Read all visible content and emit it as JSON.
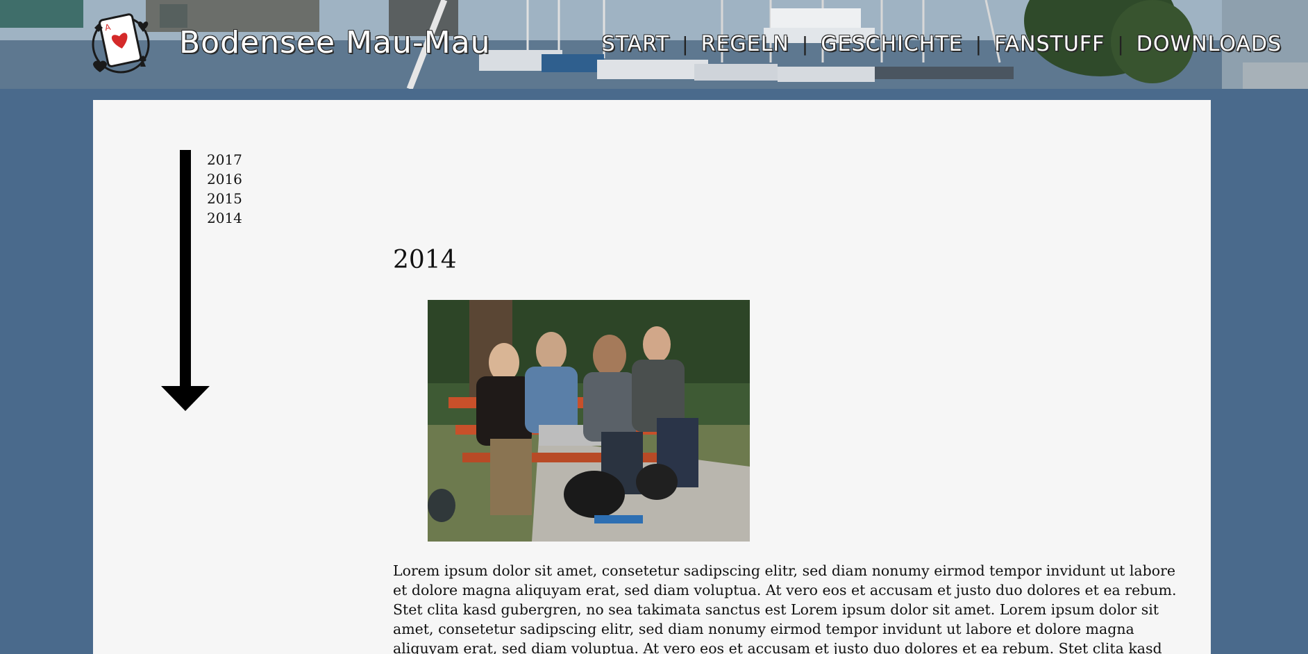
{
  "header": {
    "site_title": "Bodensee Mau-Mau",
    "nav": [
      {
        "label": "START"
      },
      {
        "label": "REGELN"
      },
      {
        "label": "GESCHICHTE"
      },
      {
        "label": "FANSTUFF"
      },
      {
        "label": "DOWNLOADS"
      }
    ],
    "nav_separator": "|"
  },
  "sidebar": {
    "years": [
      "2017",
      "2016",
      "2015",
      "2014"
    ]
  },
  "main": {
    "section_title": "2014",
    "paragraph": "Lorem ipsum dolor sit amet, consetetur sadipscing elitr, sed diam nonumy eirmod tempor invidunt ut labore et dolore magna aliquyam erat, sed diam voluptua. At vero eos et accusam et justo duo dolores et ea rebum. Stet clita kasd gubergren, no sea takimata sanctus est Lorem ipsum dolor sit amet. Lorem ipsum dolor sit amet, consetetur sadipscing elitr, sed diam nonumy eirmod tempor invidunt ut labore et dolore magna aliquyam erat, sed diam voluptua. At vero eos et accusam et justo duo dolores et ea rebum. Stet clita kasd gubergren, no sea takimata sanctus"
  },
  "colors": {
    "page_background": "#4a6a8c",
    "content_background": "#f6f6f6",
    "card_red": "#d42a2a"
  },
  "icons": {
    "logo": "playing-card-logo",
    "timeline": "arrow-down-icon"
  }
}
